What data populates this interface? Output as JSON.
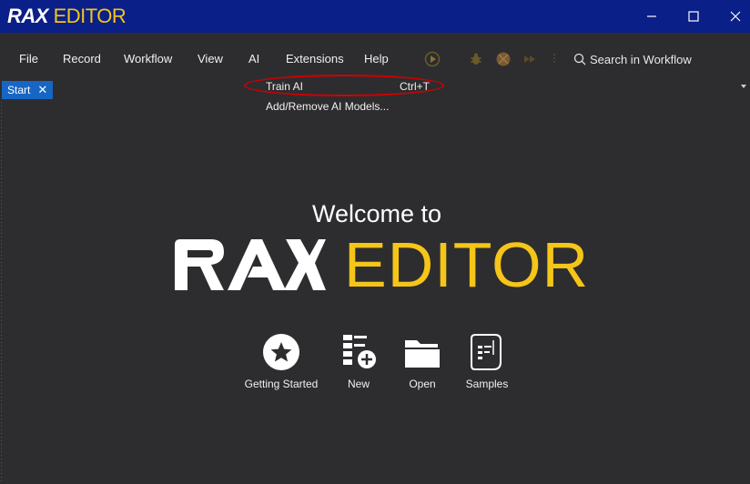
{
  "window": {
    "logo_rax": "RAX",
    "logo_editor": "EDITOR",
    "minimize_icon": "minimize-icon",
    "maximize_icon": "maximize-icon",
    "close_icon": "close-icon"
  },
  "menu": {
    "items": [
      "File",
      "Record",
      "Workflow",
      "View",
      "AI",
      "Extensions",
      "Help"
    ],
    "toolbar_icons": [
      "run-icon",
      "debug-icon",
      "stop-icon",
      "step-forward-icon",
      "breakpoint-icon"
    ],
    "search_placeholder": "Search in Workflow"
  },
  "tabs": [
    {
      "label": "Start",
      "active": true
    }
  ],
  "ai_menu": {
    "items": [
      {
        "label": "Train AI",
        "shortcut": "Ctrl+T"
      },
      {
        "label": "Add/Remove AI Models...",
        "shortcut": ""
      }
    ]
  },
  "welcome": {
    "heading": "Welcome to",
    "brand_rax": "RAX",
    "brand_editor": "EDITOR"
  },
  "actions": [
    {
      "label": "Getting Started",
      "icon": "star-icon"
    },
    {
      "label": "New",
      "icon": "new-workflow-icon"
    },
    {
      "label": "Open",
      "icon": "folder-icon"
    },
    {
      "label": "Samples",
      "icon": "samples-icon"
    }
  ],
  "colors": {
    "titlebar": "#0a1f87",
    "background": "#2d2d30",
    "accent_yellow": "#f5c518",
    "tab_active": "#1766c4",
    "highlight": "#d00000"
  }
}
